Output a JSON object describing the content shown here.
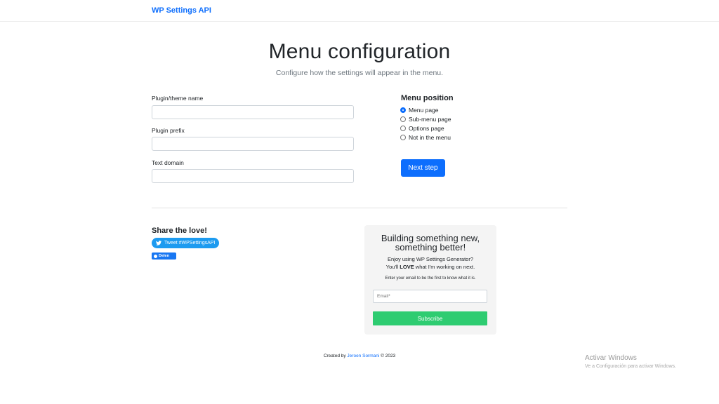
{
  "navbar": {
    "brand": "WP Settings API"
  },
  "hero": {
    "title": "Menu configuration",
    "subtitle": "Configure how the settings will appear in the menu."
  },
  "form": {
    "fields": [
      {
        "label": "Plugin/theme name",
        "value": "",
        "placeholder": ""
      },
      {
        "label": "Plugin prefix",
        "value": "",
        "placeholder": ""
      },
      {
        "label": "Text domain",
        "value": "",
        "placeholder": ""
      }
    ]
  },
  "menu_position": {
    "title": "Menu position",
    "options": [
      {
        "label": "Menu page",
        "checked": true
      },
      {
        "label": "Sub-menu page",
        "checked": false
      },
      {
        "label": "Options page",
        "checked": false
      },
      {
        "label": "Not in the menu",
        "checked": false
      }
    ],
    "next_label": "Next step"
  },
  "share": {
    "title": "Share the love!",
    "tweet_label": "Tweet #WPSettingsAPI",
    "fb_label": "Delen"
  },
  "newsletter": {
    "title_line1": "Building something new,",
    "title_line2": "something better!",
    "line1": "Enjoy using WP Settings Generator?",
    "line2_pre": "You'll ",
    "line2_bold": "LOVE",
    "line2_post": " what I'm working on next.",
    "small": "Enter your email to be the first to know what it is.",
    "email_placeholder": "Email*",
    "subscribe_label": "Subscribe"
  },
  "footer": {
    "pre": "Created by ",
    "author": "Jeroen Sormani",
    "post": " © 2023"
  },
  "windows_watermark": {
    "title": "Activar Windows",
    "subtitle": "Ve a Configuración para activar Windows."
  },
  "colors": {
    "primary": "#0d6efd",
    "twitter": "#1d9bf0",
    "facebook": "#1877f2",
    "subscribe": "#2ecc71"
  }
}
